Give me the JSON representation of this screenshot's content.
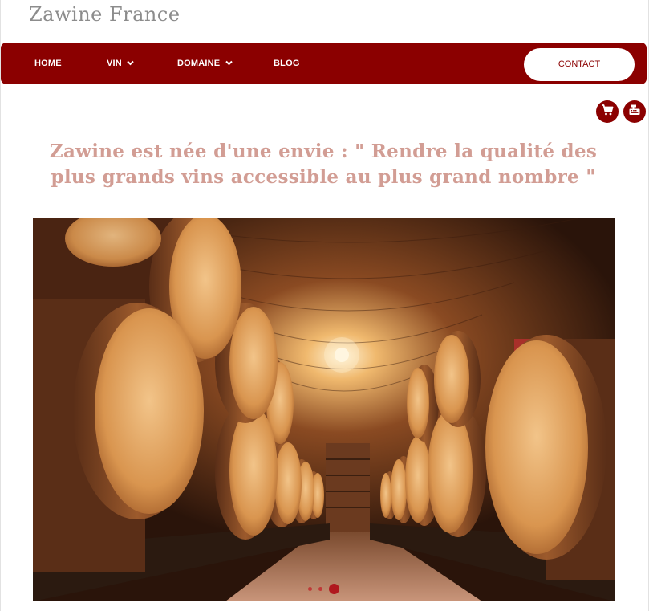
{
  "header": {
    "site_title": "Zawine France"
  },
  "nav": {
    "items": [
      {
        "label": "HOME",
        "has_dropdown": false
      },
      {
        "label": "VIN",
        "has_dropdown": true
      },
      {
        "label": "DOMAINE",
        "has_dropdown": true
      },
      {
        "label": "BLOG",
        "has_dropdown": false
      }
    ],
    "contact_label": "CONTACT"
  },
  "actions": {
    "icons": [
      "cart-icon",
      "cash-register-icon"
    ]
  },
  "main": {
    "tagline": "Zawine est née d'une envie : \" Rendre la qualité des plus grands vins accessible au plus grand nombre \""
  },
  "hero": {
    "image": "wine-cellar-barrels",
    "slides_total": 3,
    "active_slide": 3
  },
  "colors": {
    "brand": "#8b0000",
    "tagline": "#d29d94",
    "title": "#8c8c8c"
  }
}
